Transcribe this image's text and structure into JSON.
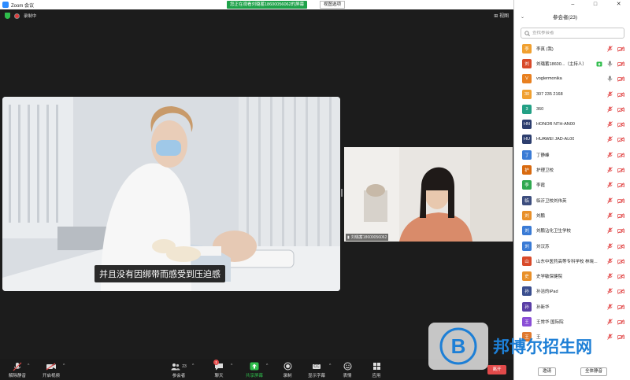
{
  "window": {
    "title": "Zoom 会议",
    "share_banner": "您正在观看刘璐蓄18600056062的屏幕",
    "share_options": "视图选项",
    "controls": [
      "–",
      "□",
      "✕"
    ]
  },
  "stage": {
    "recording_label": "录制中",
    "view_button": "视图",
    "subtitle": "并且没有因绑带而感受到压迫感",
    "thumbnail_label": "刘璐蓄18600056062"
  },
  "toolbar": {
    "mute": "解除静音",
    "video": "开启视频",
    "participants": "参会者",
    "participants_count": "23",
    "chat": "聊天",
    "chat_badge": "1",
    "share": "共享屏幕",
    "record": "录制",
    "captions": "显示字幕",
    "captions_icon": "CC",
    "reactions": "表情",
    "apps": "应用",
    "end": "离开"
  },
  "panel": {
    "title": "参会者(23)",
    "search_placeholder": "查找参会者",
    "participants": [
      {
        "avatar": "李",
        "color": "#f0a030",
        "name": "李真 (我)",
        "icons": [
          "mic-off-icon",
          "video-off-icon"
        ]
      },
      {
        "avatar": "刘",
        "color": "#d84a2a",
        "name": "刘璐蓄18600...（主持人）",
        "icons": [
          "share-icon",
          "mic-icon",
          "video-off-icon"
        ]
      },
      {
        "avatar": "V",
        "color": "#e88020",
        "name": "voglermonika",
        "icons": [
          "mic-icon",
          "video-off-icon"
        ]
      },
      {
        "avatar": "30",
        "color": "#f0a030",
        "name": "307 235 2168",
        "icons": [
          "mic-off-icon",
          "video-off-icon"
        ]
      },
      {
        "avatar": "3",
        "color": "#23a085",
        "name": "360",
        "icons": [
          "mic-off-icon",
          "video-off-icon"
        ]
      },
      {
        "avatar": "HN",
        "color": "#2d3e6e",
        "name": "HONOR NTH-AN00",
        "icons": [
          "mic-off-icon",
          "video-off-icon"
        ]
      },
      {
        "avatar": "HU",
        "color": "#2d3e6e",
        "name": "HUAWEI JAD-AL00",
        "icons": [
          "mic-off-icon",
          "video-off-icon"
        ]
      },
      {
        "avatar": "丁",
        "color": "#3a7bd5",
        "name": "丁静峰",
        "icons": [
          "mic-off-icon",
          "video-off-icon"
        ]
      },
      {
        "avatar": "护",
        "color": "#d86a10",
        "name": "护理卫校",
        "icons": [
          "mic-off-icon",
          "video-off-icon"
        ]
      },
      {
        "avatar": "李",
        "color": "#2fa84f",
        "name": "李霞",
        "icons": [
          "mic-off-icon",
          "video-off-icon"
        ]
      },
      {
        "avatar": "临",
        "color": "#3d4e7e",
        "name": "临沂卫校刘伟英",
        "icons": [
          "mic-off-icon",
          "video-off-icon"
        ]
      },
      {
        "avatar": "刘",
        "color": "#e8902a",
        "name": "刘鹏",
        "icons": [
          "mic-off-icon",
          "video-off-icon"
        ]
      },
      {
        "avatar": "刘",
        "color": "#3a7bd5",
        "name": "刘鹏沾化卫生学校",
        "icons": [
          "mic-off-icon",
          "video-off-icon"
        ]
      },
      {
        "avatar": "刘",
        "color": "#3a7bd5",
        "name": "刘汉苏",
        "icons": [
          "mic-off-icon",
          "video-off-icon"
        ]
      },
      {
        "avatar": "山",
        "color": "#d84a2a",
        "name": "山东中医药高等专科学校 林晓...",
        "icons": [
          "mic-off-icon",
          "video-off-icon"
        ]
      },
      {
        "avatar": "史",
        "color": "#e8902a",
        "name": "史学敏保健院",
        "icons": [
          "mic-off-icon",
          "video-off-icon"
        ]
      },
      {
        "avatar": "孙",
        "color": "#3a4e8e",
        "name": "孙洁的iPad",
        "icons": [
          "mic-off-icon",
          "video-off-icon"
        ]
      },
      {
        "avatar": "孙",
        "color": "#5a3ea6",
        "name": "孙新华",
        "icons": [
          "mic-off-icon",
          "video-off-icon"
        ]
      },
      {
        "avatar": "王",
        "color": "#8a4ed6",
        "name": "王常华 国际院",
        "icons": [
          "mic-off-icon",
          "video-off-icon"
        ]
      },
      {
        "avatar": "王",
        "color": "#e07a30",
        "name": "王",
        "icons": [
          "mic-off-icon",
          "video-off-icon"
        ]
      }
    ],
    "invite_button": "邀请",
    "mute_all_button": "全体静音"
  },
  "watermark": {
    "text": "邦博尔招生网",
    "logo_letter": "B"
  }
}
